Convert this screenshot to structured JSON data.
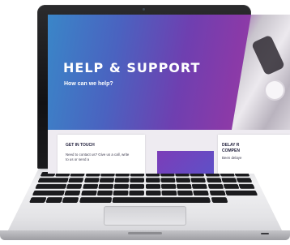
{
  "hero": {
    "title": "HELP & SUPPORT",
    "subtitle": "How can we help?"
  },
  "cards": {
    "get_in_touch": {
      "heading": "GET IN TOUCH",
      "text": "Need to contact us? Give us a call, write to us or send a"
    },
    "delay": {
      "heading": "DELAY R\nCOMPEN",
      "text": "Been delaye"
    }
  },
  "colors": {
    "hero_gradient_start": "#3a86c8",
    "hero_gradient_end": "#a0489c",
    "heading_text": "#1f1d3a"
  }
}
